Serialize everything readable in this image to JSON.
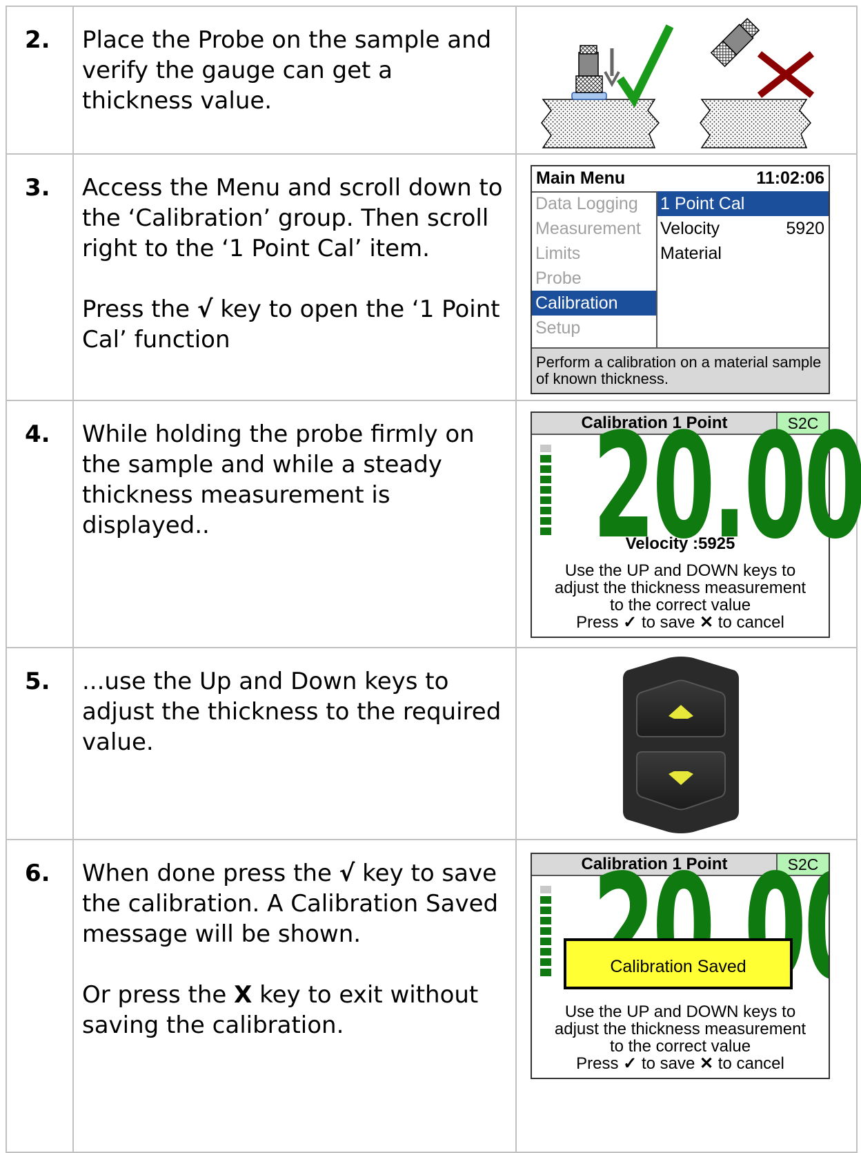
{
  "steps": [
    {
      "number": "2.",
      "text": "Place the Probe on the sample and verify the gauge can get a thickness value."
    },
    {
      "number": "3.",
      "text1": "Access the Menu and scroll down to the ‘Calibration’ group. Then scroll right to the ‘1 Point Cal’ item.",
      "text2_pre": "Press the ",
      "text2_key": "√",
      "text2_post": " key to open the ‘1 Point Cal’ function"
    },
    {
      "number": "4.",
      "text": "While holding the probe firmly on the sample and while a steady thickness measurement is displayed.."
    },
    {
      "number": "5.",
      "text": "...use the Up and Down keys to adjust the thickness to the required value."
    },
    {
      "number": "6.",
      "text1_pre": "When done press the ",
      "text1_key": "√",
      "text1_post": " key to save the calibration. A Calibration Saved message will be shown.",
      "text2_pre": "Or press the ",
      "text2_key": "X",
      "text2_post": " key to exit without saving the calibration."
    }
  ],
  "main_menu": {
    "title": "Main Menu",
    "time": "11:02:06",
    "groups": [
      "Data Logging",
      "Measurement",
      "Limits",
      "Probe",
      "Calibration",
      "Setup"
    ],
    "selected_group": 4,
    "items": [
      {
        "label": "1 Point Cal",
        "value": ""
      },
      {
        "label": "Velocity",
        "value": "5920"
      },
      {
        "label": "Material",
        "value": ""
      }
    ],
    "selected_item": 0,
    "footer": "Perform a calibration on a material sample of known thickness."
  },
  "cal_screen": {
    "title": "Calibration 1 Point",
    "badge": "S2C",
    "reading": "20.00",
    "velocity": "Velocity :5925",
    "instr_line1": "Use the UP and DOWN keys to",
    "instr_line2": "adjust the thickness measurement",
    "instr_line3": "to the correct value",
    "save_word_pre": "Press",
    "save_check": "✓",
    "save_mid": "to save",
    "save_x": "✕",
    "save_post": "to cancel",
    "saved_message": "Calibration Saved"
  },
  "colors": {
    "reading_green": "#0f7a0f",
    "menu_select": "#1b4e9b",
    "badge_bg": "#b6f4b6",
    "saved_bg": "#ffff33",
    "check_green": "#1a9a1a",
    "cross_red": "#8b0000",
    "key_arrow": "#e8e83a"
  },
  "icons": {
    "probe_ok": "probe-on-sample-check-icon",
    "probe_bad": "probe-tilted-cross-icon",
    "up_key": "up-arrow-key-icon",
    "down_key": "down-arrow-key-icon"
  }
}
